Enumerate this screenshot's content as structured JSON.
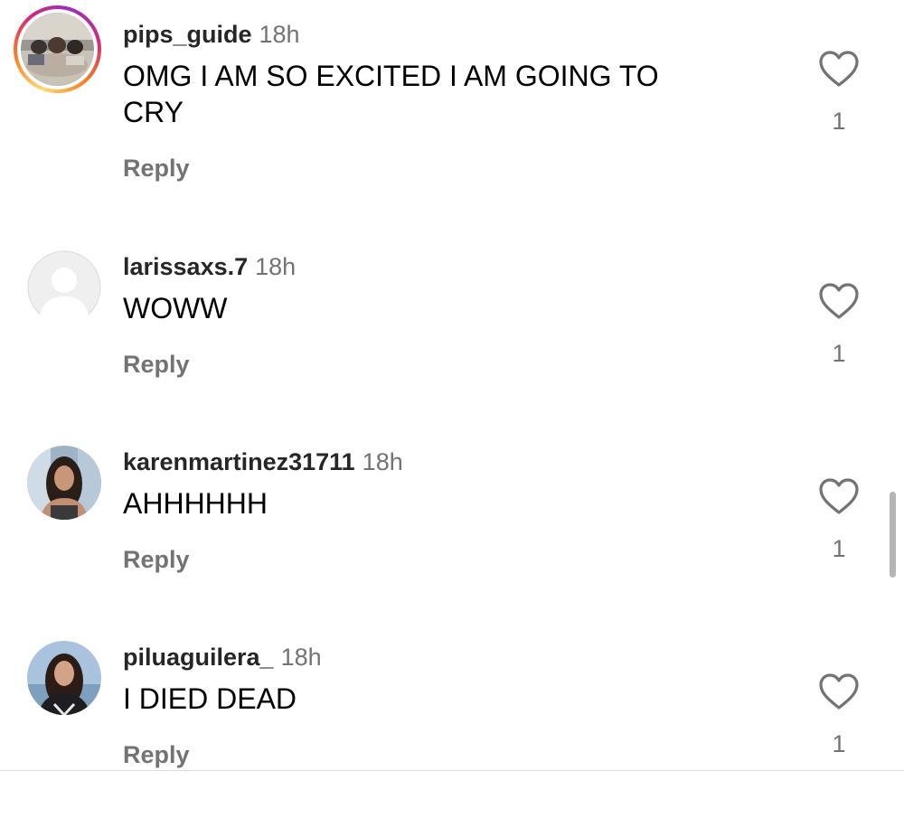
{
  "comments": [
    {
      "username": "pips_guide",
      "time": "18h",
      "text": "OMG I AM SO EXCITED I AM GOING TO CRY",
      "reply_label": "Reply",
      "likes": "1",
      "avatar_icon": "profile-photo-group",
      "has_story_ring": true
    },
    {
      "username": "larissaxs.7",
      "time": "18h",
      "text": "WOWW",
      "reply_label": "Reply",
      "likes": "1",
      "avatar_icon": "default-profile-icon",
      "has_story_ring": false
    },
    {
      "username": "karenmartinez31711",
      "time": "18h",
      "text": "AHHHHHH",
      "reply_label": "Reply",
      "likes": "1",
      "avatar_icon": "profile-photo",
      "has_story_ring": false
    },
    {
      "username": "piluaguilera_",
      "time": "18h",
      "text": "I DIED DEAD",
      "reply_label": "Reply",
      "likes": "1",
      "avatar_icon": "profile-photo",
      "has_story_ring": false
    }
  ],
  "colors": {
    "username": "#262626",
    "secondary_text": "#737373",
    "heart_outline": "#737373",
    "story_ring": [
      "#feda75",
      "#fa7e1e",
      "#d62976",
      "#962fbf"
    ],
    "divider": "#dbdbdb",
    "scrollbar": "#b5b5b5"
  }
}
